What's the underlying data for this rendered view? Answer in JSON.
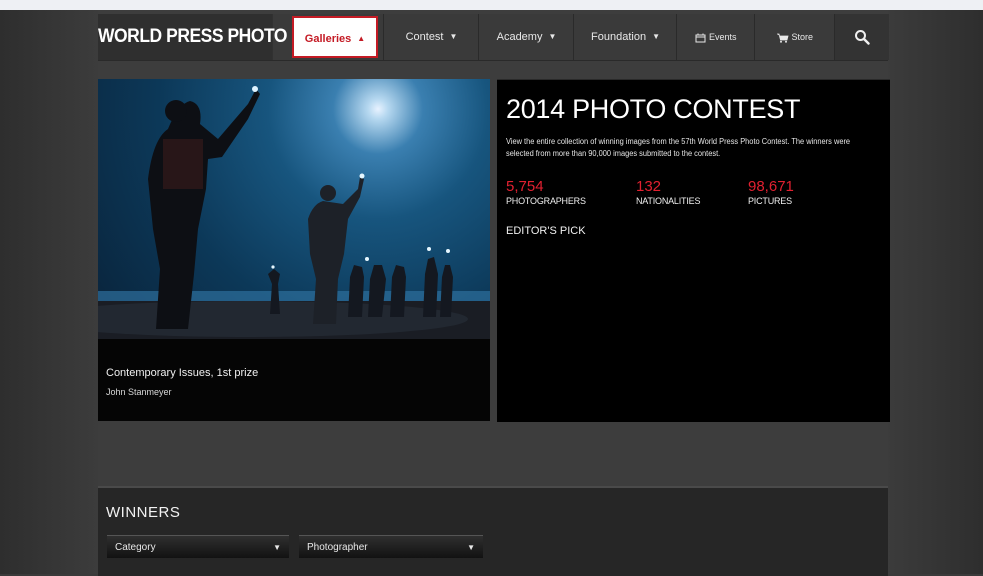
{
  "nav": {
    "logo": "WORLD PRESS PHOTO",
    "galleries": "Galleries",
    "contest": "Contest",
    "academy": "Academy",
    "foundation": "Foundation",
    "events": "Events",
    "store": "Store"
  },
  "hero": {
    "caption_title": "Contemporary Issues, 1st prize",
    "caption_author": "John Stanmeyer"
  },
  "contest": {
    "title": "2014 PHOTO CONTEST",
    "description": "View the entire collection of winning images from the 57th World Press Photo Contest. The winners were selected from more than 90,000 images submitted to the contest.",
    "stats": [
      {
        "value": "5,754",
        "label": "PHOTOGRAPHERS"
      },
      {
        "value": "132",
        "label": "NATIONALITIES"
      },
      {
        "value": "98,671",
        "label": "PICTURES"
      }
    ],
    "editors_pick": "EDITOR'S PICK"
  },
  "winners": {
    "heading": "WINNERS",
    "category_select": "Category",
    "photographer_select": "Photographer"
  },
  "colors": {
    "accent_red": "#c41a24",
    "stat_red": "#e02030",
    "panel_black": "#000000"
  }
}
